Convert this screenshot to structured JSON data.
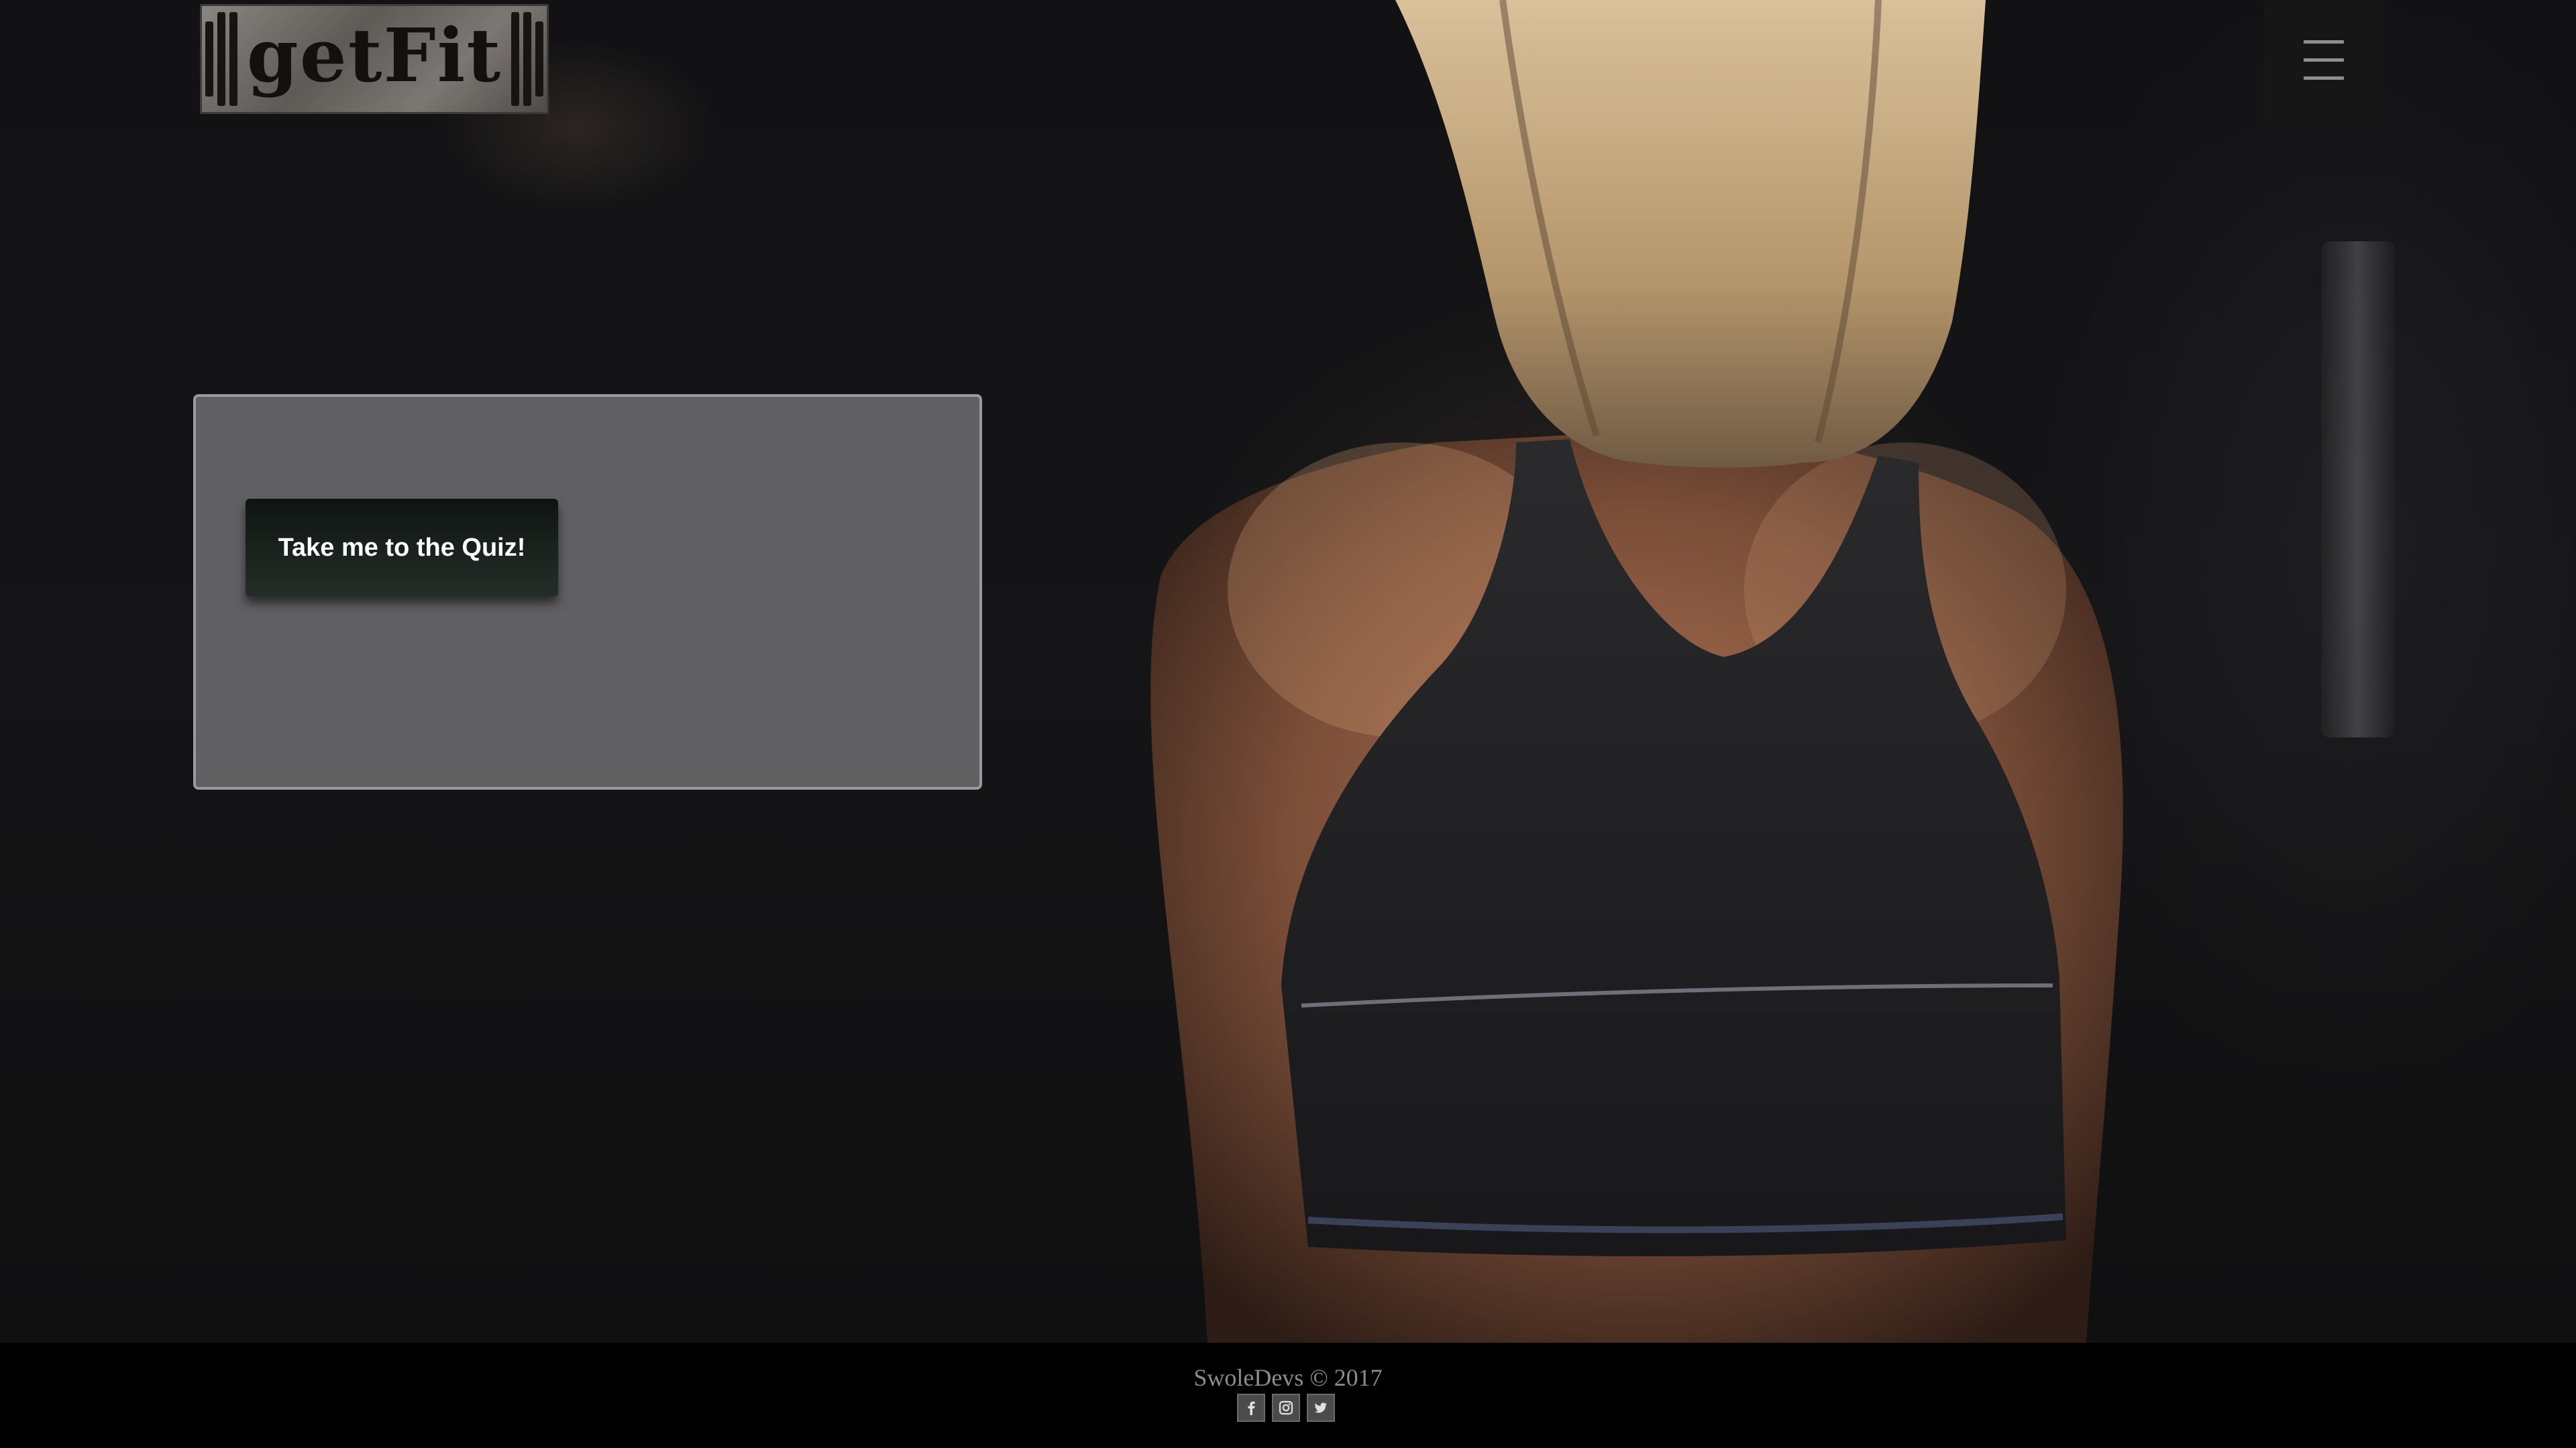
{
  "header": {
    "logo_text": "getFit",
    "menu_icon": "hamburger-menu-icon"
  },
  "quiz_panel": {
    "button_label": "Take me to the Quiz!"
  },
  "footer": {
    "copyright": "SwoleDevs © 2017",
    "social": [
      {
        "name": "facebook-icon"
      },
      {
        "name": "instagram-icon"
      },
      {
        "name": "twitter-icon"
      }
    ]
  },
  "colors": {
    "footer_background": "#000000",
    "panel_background": "#76767a",
    "button_background": "#1a221d",
    "button_text": "#ffffff"
  }
}
